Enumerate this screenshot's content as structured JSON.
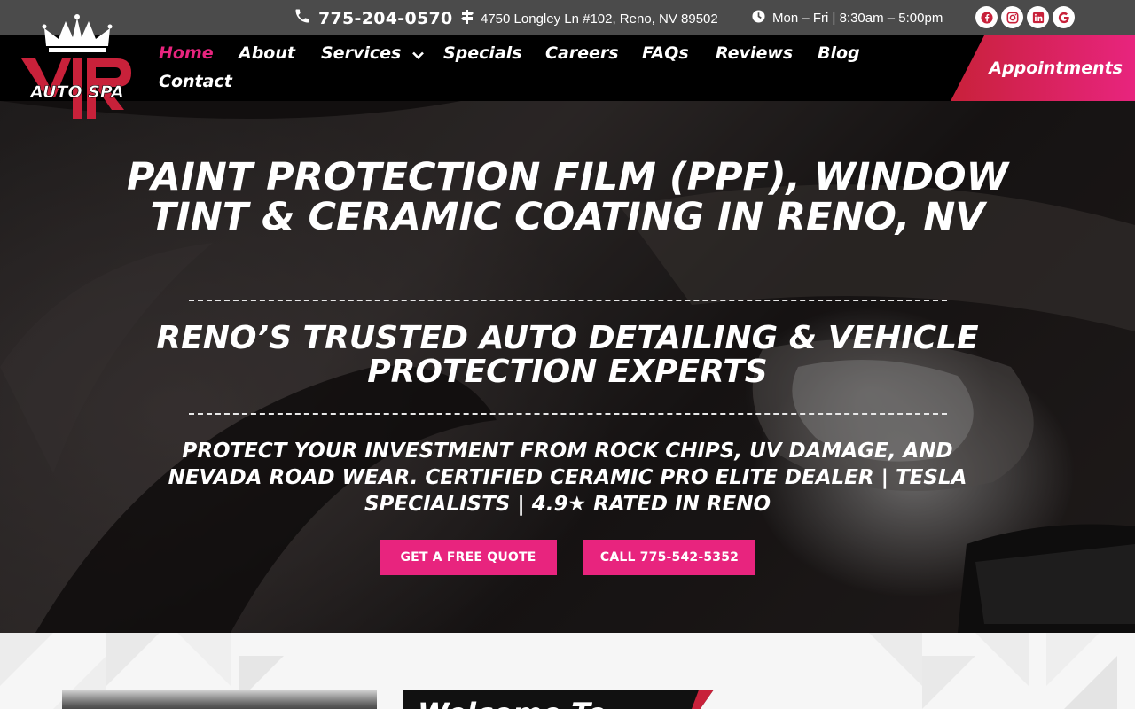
{
  "topbar": {
    "phone": "775-204-0570",
    "address": "4750 Longley Ln #102, Reno, NV 89502",
    "hours": "Mon – Fri | 8:30am – 5:00pm",
    "social_icons": [
      "facebook-icon",
      "instagram-icon",
      "linkedin-icon",
      "google-icon"
    ]
  },
  "brand": {
    "logo_text": "AUTO SPA",
    "accent": "#e8247e",
    "accent_red": "#c8213a"
  },
  "nav": {
    "items": [
      "Home",
      "About",
      "Services",
      "Specials",
      "Careers",
      "FAQs",
      "Reviews",
      "Blog",
      "Contact"
    ],
    "active": "Home",
    "appointments": "Appointments"
  },
  "hero": {
    "title": "Paint Protection Film (PPF), Window Tint & Ceramic Coating in Reno, NV",
    "subtitle": "Reno’s Trusted Auto Detailing & Vehicle Protection Experts",
    "tagline": "Protect your investment from rock chips, UV damage, and Nevada road wear. Certified Ceramic Pro Elite Dealer | Tesla Specialists | 4.9★ Rated in Reno",
    "cta_quote": "GET A FREE QUOTE",
    "cta_call": "CALL 775-542-5352"
  },
  "welcome": {
    "heading": "Welcome To"
  }
}
